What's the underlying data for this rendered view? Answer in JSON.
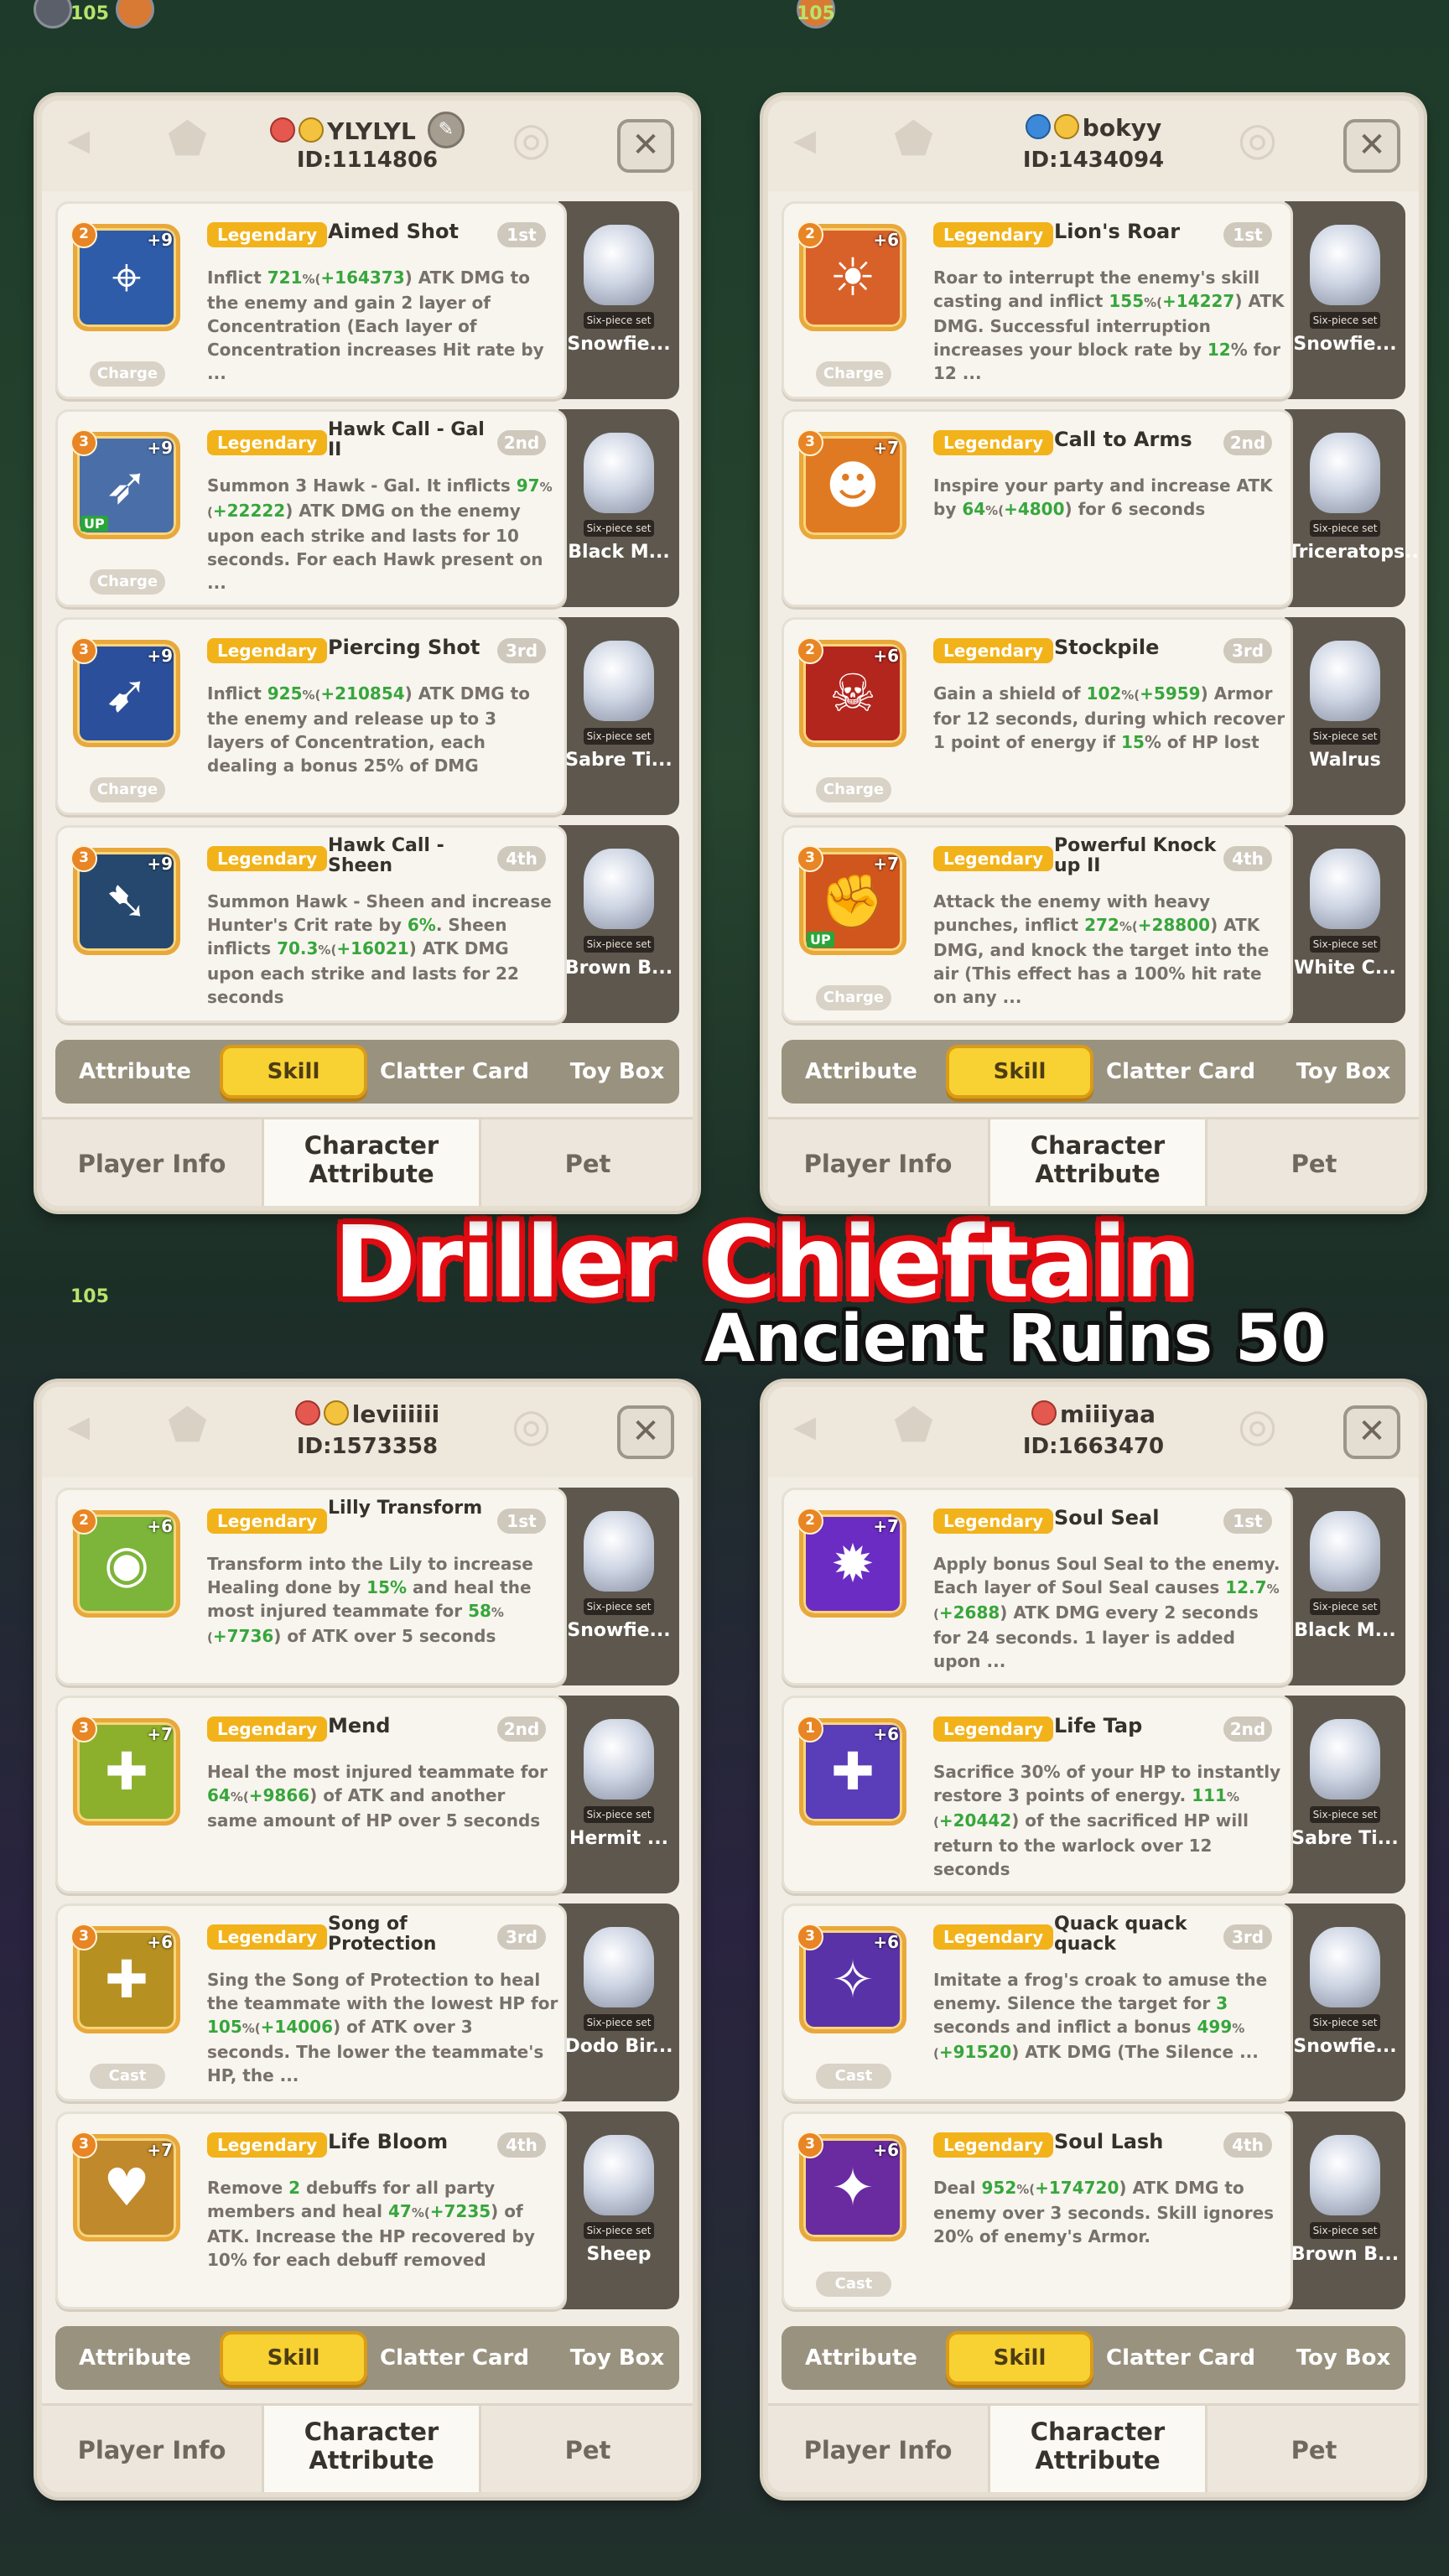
{
  "banner": {
    "title": "Driller Chieftain",
    "subtitle": "Ancient Ruins 50"
  },
  "hud": {
    "top_value": "105",
    "mid_value": "105"
  },
  "tabs": [
    "Attribute",
    "Skill",
    "Clatter Card",
    "Toy Box"
  ],
  "bottom_tabs": {
    "player_info": "Player Info",
    "character_attribute_1": "Character",
    "character_attribute_2": "Attribute",
    "pet": "Pet"
  },
  "colors": {
    "legendary": "#f2b21a",
    "highlight_green": "#37a63c",
    "active_tab": "#f8d133"
  },
  "players": [
    {
      "name": "YLYLYL",
      "id": "ID:1114806",
      "badges": [
        "red-pin-icon",
        "face-icon"
      ],
      "skills": [
        {
          "icon": "crosshair-icon",
          "level": "2",
          "plus": "+9",
          "up": "",
          "mode": "Charge",
          "rarity": "Legendary",
          "name": "Aimed Shot",
          "order": "1st",
          "desc": [
            "Inflict ",
            "721",
            "%(",
            "+164373",
            ") ATK DMG to the enemy and gain 2 layer of Concentration (Each layer of Concentration increases Hit rate by ..."
          ],
          "pet": "Snowfie..."
        },
        {
          "icon": "hawk-icon",
          "level": "3",
          "plus": "+9",
          "up": "UP",
          "mode": "Charge",
          "rarity": "Legendary",
          "name": "Hawk Call - Gal II",
          "order": "2nd",
          "desc": [
            "Summon 3 Hawk - Gal. It inflicts ",
            "97",
            "%(",
            "+22222",
            ") ATK DMG on the enemy upon each strike and lasts for 10 seconds. For each Hawk present on ..."
          ],
          "pet": "Black M..."
        },
        {
          "icon": "arrows-icon",
          "level": "3",
          "plus": "+9",
          "up": "",
          "mode": "Charge",
          "rarity": "Legendary",
          "name": "Piercing Shot",
          "order": "3rd",
          "desc": [
            "Inflict ",
            "925",
            "%(",
            "+210854",
            ") ATK DMG to the enemy and release up to 3 layers of Concentration, each dealing a bonus 25% of DMG"
          ],
          "pet": "Sabre Ti..."
        },
        {
          "icon": "hawk-dark-icon",
          "level": "3",
          "plus": "+9",
          "up": "",
          "mode": "",
          "rarity": "Legendary",
          "name": "Hawk Call - Sheen",
          "order": "4th",
          "desc": [
            "Summon Hawk - Sheen and increase Hunter's Crit rate by ",
            "6%",
            ". Sheen inflicts ",
            "70.3",
            "%(",
            "+16021",
            ") ATK DMG upon each strike and lasts for 22 seconds"
          ],
          "pet": "Brown B..."
        }
      ]
    },
    {
      "name": "bokyy",
      "id": "ID:1434094",
      "badges": [
        "blue-pin-icon",
        "face-icon"
      ],
      "skills": [
        {
          "icon": "lion-icon",
          "level": "2",
          "plus": "+6",
          "up": "",
          "mode": "Charge",
          "rarity": "Legendary",
          "name": "Lion's Roar",
          "order": "1st",
          "desc": [
            "Roar to interrupt the enemy's skill casting and inflict ",
            "155",
            "%(",
            "+14227",
            ") ATK DMG. Successful interruption increases your block rate by ",
            "12",
            "% for 12 ..."
          ],
          "pet": "Snowfie..."
        },
        {
          "icon": "warrior-icon",
          "level": "3",
          "plus": "+7",
          "up": "",
          "mode": "",
          "rarity": "Legendary",
          "name": "Call to Arms",
          "order": "2nd",
          "desc": [
            "Inspire your party and increase ATK by ",
            "64",
            "%(",
            "+4800",
            ") for 6 seconds"
          ],
          "pet": "Triceratops..."
        },
        {
          "icon": "skull-shield-icon",
          "level": "2",
          "plus": "+6",
          "up": "",
          "mode": "Charge",
          "rarity": "Legendary",
          "name": "Stockpile",
          "order": "3rd",
          "desc": [
            "Gain a shield of ",
            "102",
            "%(",
            "+5959",
            ") Armor for 12 seconds, during which recover 1 point of energy if ",
            "15",
            "% of HP lost"
          ],
          "pet": "Walrus"
        },
        {
          "icon": "fist-icon",
          "level": "3",
          "plus": "+7",
          "up": "UP",
          "mode": "Charge",
          "rarity": "Legendary",
          "name": "Powerful Knock up II",
          "order": "4th",
          "desc": [
            "Attack the enemy with heavy punches, inflict ",
            "272",
            "%(",
            "+28800",
            ") ATK DMG, and knock the target into the air (This effect has a 100% hit rate on any ..."
          ],
          "pet": "White C..."
        }
      ]
    },
    {
      "name": "leviiiiii",
      "id": "ID:1573358",
      "badges": [
        "red-pin-icon",
        "face-icon"
      ],
      "skills": [
        {
          "icon": "owl-icon",
          "level": "2",
          "plus": "+6",
          "up": "",
          "mode": "",
          "rarity": "Legendary",
          "name": "Lilly Transform",
          "order": "1st",
          "desc": [
            "Transform into the Lily to increase Healing done by ",
            "15%",
            " and heal the most injured teammate for ",
            "58",
            "%(",
            "+7736",
            ") of ATK over 5 seconds"
          ],
          "pet": "Snowfie..."
        },
        {
          "icon": "heal-cross-icon",
          "level": "3",
          "plus": "+7",
          "up": "",
          "mode": "",
          "rarity": "Legendary",
          "name": "Mend",
          "order": "2nd",
          "desc": [
            "Heal the most injured teammate for ",
            "64",
            "%(",
            "+9866",
            ") of ATK and another same amount of HP over 5 seconds"
          ],
          "pet": "Hermit ..."
        },
        {
          "icon": "song-cross-icon",
          "level": "3",
          "plus": "+6",
          "up": "",
          "mode": "Cast",
          "rarity": "Legendary",
          "name": "Song of Protection",
          "order": "3rd",
          "desc": [
            "Sing the Song of Protection to heal the teammate with the lowest HP for ",
            "105",
            "%(",
            "+14006",
            ") of ATK over 3 seconds. The lower the teammate's HP, the ..."
          ],
          "pet": "Dodo Bir..."
        },
        {
          "icon": "heart-icon",
          "level": "3",
          "plus": "+7",
          "up": "",
          "mode": "",
          "rarity": "Legendary",
          "name": "Life Bloom",
          "order": "4th",
          "desc": [
            "Remove ",
            "2",
            " debuffs for all party members and heal ",
            "47",
            "%(",
            "+7235",
            ") of ATK. Increase the HP recovered by 10% for each debuff removed"
          ],
          "pet": "Sheep"
        }
      ]
    },
    {
      "name": "miiiyaa",
      "id": "ID:1663470",
      "badges": [
        "red-pin-icon"
      ],
      "skills": [
        {
          "icon": "soul-flame-icon",
          "level": "2",
          "plus": "+7",
          "up": "",
          "mode": "",
          "rarity": "Legendary",
          "name": "Soul Seal",
          "order": "1st",
          "desc": [
            "Apply bonus Soul Seal to the enemy. Each layer of Soul Seal causes ",
            "12.7",
            "%(",
            "+2688",
            ") ATK DMG every 2 seconds for 24 seconds. 1 layer is added upon ..."
          ],
          "pet": "Black M..."
        },
        {
          "icon": "life-tap-icon",
          "level": "1",
          "plus": "+6",
          "up": "",
          "mode": "",
          "rarity": "Legendary",
          "name": "Life Tap",
          "order": "2nd",
          "desc": [
            "Sacrifice 30% of your HP to instantly restore 3 points of energy. ",
            "111",
            "%(",
            "+20442",
            ") of the sacrificed HP will return to the warlock over 12 seconds"
          ],
          "pet": "Sabre Ti..."
        },
        {
          "icon": "frog-icon",
          "level": "3",
          "plus": "+6",
          "up": "",
          "mode": "Cast",
          "rarity": "Legendary",
          "name": "Quack quack quack",
          "order": "3rd",
          "desc": [
            "Imitate a frog's croak to amuse the enemy. Silence the target for ",
            "3",
            " seconds and inflict a bonus ",
            "499",
            "%(",
            "+91520",
            ") ATK DMG (The Silence ..."
          ],
          "pet": "Snowfie..."
        },
        {
          "icon": "lash-icon",
          "level": "3",
          "plus": "+6",
          "up": "",
          "mode": "Cast",
          "rarity": "Legendary",
          "name": "Soul Lash",
          "order": "4th",
          "desc": [
            "Deal ",
            "952",
            "%(",
            "+174720",
            ") ATK DMG to enemy over 3 seconds. Skill ignores 20% of enemy's Armor."
          ],
          "pet": "Brown B..."
        }
      ]
    }
  ]
}
